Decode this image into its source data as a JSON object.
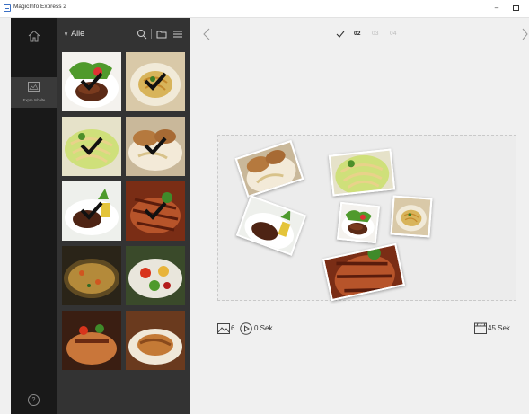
{
  "window": {
    "title": "MagicInfo Express 2",
    "minimize_glyph": "–"
  },
  "nav": {
    "items": [
      {
        "label": "Expre Inhalte",
        "icon": "image-icon"
      }
    ],
    "help_label": "?"
  },
  "gallery": {
    "filter_label": "Alle",
    "thumbnails": [
      {
        "subject": "steak-salad",
        "checked": true
      },
      {
        "subject": "pasta-bowl",
        "checked": true
      },
      {
        "subject": "pasta-salad",
        "checked": true
      },
      {
        "subject": "bread-plate",
        "checked": true
      },
      {
        "subject": "steak-plate",
        "checked": true
      },
      {
        "subject": "grilled-meat",
        "checked": true
      },
      {
        "subject": "paella-pan",
        "checked": false
      },
      {
        "subject": "vegetable-salad",
        "checked": false
      },
      {
        "subject": "bbq-dish",
        "checked": false
      },
      {
        "subject": "roast-dish",
        "checked": false
      }
    ]
  },
  "steps": {
    "items": [
      "02",
      "03",
      "04"
    ],
    "active_index": 0
  },
  "footer": {
    "image_count": "6",
    "per_image_duration": "0 Sek.",
    "total_duration": "45 Sek."
  },
  "colors": {
    "nav_bg": "#191919",
    "gallery_bg": "#333333",
    "main_bg": "#f0f0f0",
    "accent": "#222222"
  }
}
